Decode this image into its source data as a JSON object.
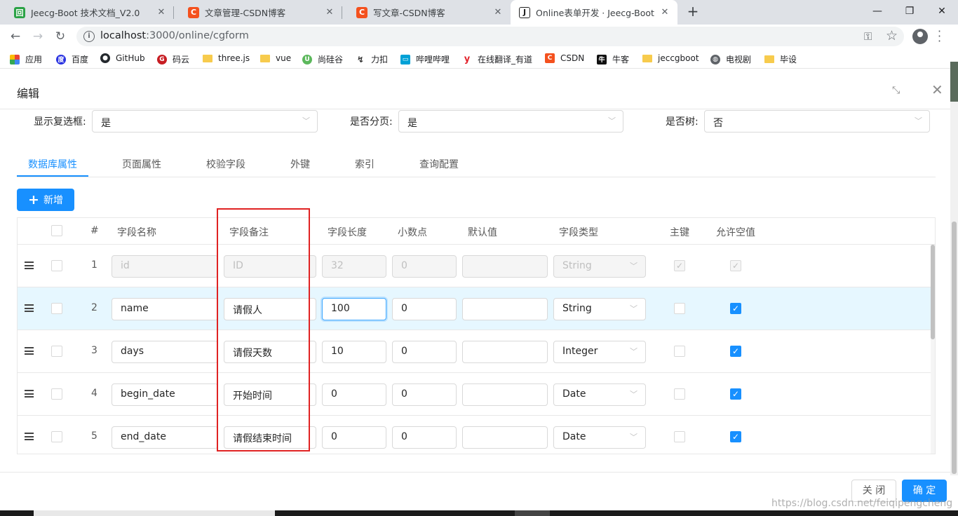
{
  "browser": {
    "tabs": [
      {
        "title": "Jeecg-Boot 技术文档_V2.0",
        "icon": "jeecg-doc-icon",
        "icon_color": "#2ba246"
      },
      {
        "title": "文章管理-CSDN博客",
        "icon": "csdn-icon",
        "icon_color": "#f4511e"
      },
      {
        "title": "写文章-CSDN博客",
        "icon": "csdn-icon",
        "icon_color": "#f4511e"
      },
      {
        "title": "Online表单开发 · Jeecg-Boot 企",
        "icon": "jeecg-j-icon",
        "icon_color": "#222222"
      }
    ],
    "url_host": "localhost",
    "url_path": ":3000/online/cgform",
    "bookmarks": [
      {
        "label": "应用",
        "icon": "apps-grid-icon"
      },
      {
        "label": "百度",
        "icon": "baidu-icon"
      },
      {
        "label": "GitHub",
        "icon": "github-icon"
      },
      {
        "label": "码云",
        "icon": "gitee-icon"
      },
      {
        "label": "three.js",
        "icon": "folder-icon"
      },
      {
        "label": "vue",
        "icon": "folder-icon"
      },
      {
        "label": "尚硅谷",
        "icon": "atguigu-icon"
      },
      {
        "label": "力扣",
        "icon": "leetcode-icon"
      },
      {
        "label": "哔哩哔哩",
        "icon": "bilibili-icon"
      },
      {
        "label": "在线翻译_有道",
        "icon": "youdao-icon"
      },
      {
        "label": "CSDN",
        "icon": "csdn-icon"
      },
      {
        "label": "牛客",
        "icon": "nowcoder-icon"
      },
      {
        "label": "jeccgboot",
        "icon": "folder-icon"
      },
      {
        "label": "电视剧",
        "icon": "globe-icon"
      },
      {
        "label": "毕设",
        "icon": "folder-icon"
      }
    ]
  },
  "modal": {
    "title": "编辑",
    "form": {
      "show_checkbox_label": "显示复选框:",
      "show_checkbox_value": "是",
      "paging_label": "是否分页:",
      "paging_value": "是",
      "tree_label": "是否树:",
      "tree_value": "否"
    },
    "tabs": [
      "数据库属性",
      "页面属性",
      "校验字段",
      "外键",
      "索引",
      "查询配置"
    ],
    "active_tab": "数据库属性",
    "add_button": "新增",
    "columns": [
      "#",
      "字段名称",
      "字段备注",
      "字段长度",
      "小数点",
      "默认值",
      "字段类型",
      "主键",
      "允许空值"
    ],
    "rows": [
      {
        "index": "1",
        "name": "id",
        "comment": "ID",
        "length": "32",
        "decimal": "0",
        "default": "",
        "type": "String",
        "primary_key": true,
        "nullable": true,
        "disabled": true
      },
      {
        "index": "2",
        "name": "name",
        "comment": "请假人",
        "length": "100",
        "decimal": "0",
        "default": "",
        "type": "String",
        "primary_key": false,
        "nullable": true,
        "disabled": false
      },
      {
        "index": "3",
        "name": "days",
        "comment": "请假天数",
        "length": "10",
        "decimal": "0",
        "default": "",
        "type": "Integer",
        "primary_key": false,
        "nullable": true,
        "disabled": false
      },
      {
        "index": "4",
        "name": "begin_date",
        "comment": "开始时间",
        "length": "0",
        "decimal": "0",
        "default": "",
        "type": "Date",
        "primary_key": false,
        "nullable": true,
        "disabled": false
      },
      {
        "index": "5",
        "name": "end_date",
        "comment": "请假结束时间",
        "length": "0",
        "decimal": "0",
        "default": "",
        "type": "Date",
        "primary_key": false,
        "nullable": true,
        "disabled": false
      }
    ],
    "footer": {
      "close_label": "关 闭",
      "ok_label": "确 定"
    }
  },
  "watermark": "https://blog.csdn.net/feiqipengcheng",
  "colors": {
    "primary": "#1890ff",
    "highlight": "#e02222",
    "row_hover": "#e6f7ff"
  }
}
